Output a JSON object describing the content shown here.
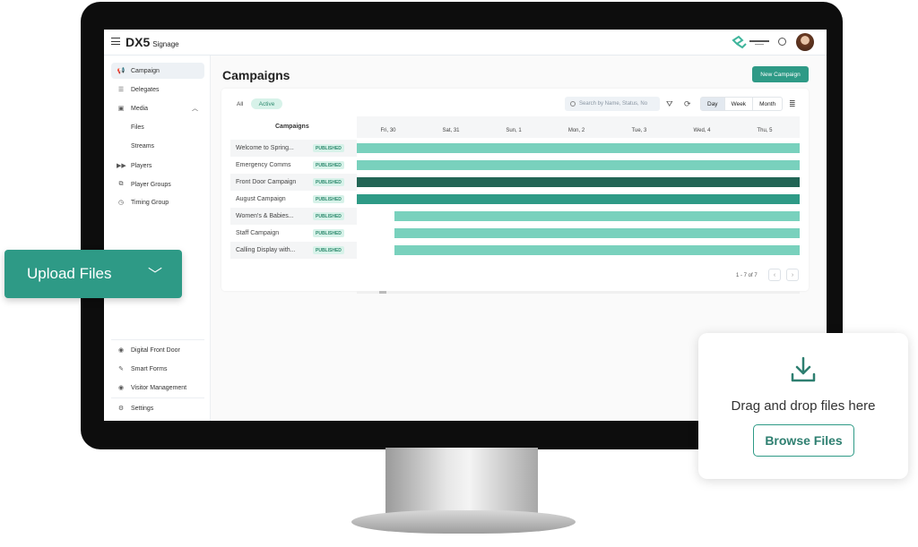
{
  "app": {
    "brand": "DX5",
    "brand_sub": "Signage",
    "logo_text": "SPRING RIVER"
  },
  "sidebar": {
    "items": [
      {
        "label": "Campaign",
        "icon": "megaphone-icon",
        "glyph": "📢"
      },
      {
        "label": "Delegates",
        "icon": "list-play-icon",
        "glyph": "☰"
      },
      {
        "label": "Media",
        "icon": "image-icon",
        "glyph": "▣"
      },
      {
        "label": "Files"
      },
      {
        "label": "Streams"
      },
      {
        "label": "Players",
        "icon": "fast-forward-icon",
        "glyph": "▶▶"
      },
      {
        "label": "Player Groups",
        "icon": "hierarchy-icon",
        "glyph": "⧉"
      },
      {
        "label": "Timing Group",
        "icon": "clock-icon",
        "glyph": "◷"
      }
    ],
    "bottom": [
      {
        "label": "Digital Front Door",
        "icon": "user-circle-icon",
        "glyph": "◉"
      },
      {
        "label": "Smart Forms",
        "icon": "form-icon",
        "glyph": "✎"
      },
      {
        "label": "Visitor Management",
        "icon": "user-circle-icon",
        "glyph": "◉"
      },
      {
        "label": "Settings",
        "icon": "gear-icon",
        "glyph": "⚙"
      }
    ]
  },
  "page": {
    "title": "Campaigns",
    "new_button": "New Campaign"
  },
  "filters": {
    "all": "All",
    "active": "Active",
    "search_placeholder": "Search by Name, Status, No",
    "views": [
      "Day",
      "Week",
      "Month"
    ],
    "selected_view": "Day"
  },
  "table": {
    "column": "Campaigns",
    "days": [
      "Fri, 30",
      "Sat, 31",
      "Sun, 1",
      "Mon, 2",
      "Tue, 3",
      "Wed, 4",
      "Thu, 5"
    ],
    "rows": [
      {
        "name": "Welcome to Spring...",
        "status": "PUBLISHED",
        "start_day": 0,
        "color": "#79d1bd"
      },
      {
        "name": "Emergency Comms",
        "status": "PUBLISHED",
        "start_day": 0,
        "color": "#79d1bd"
      },
      {
        "name": "Front Door Campaign",
        "status": "PUBLISHED",
        "start_day": 0,
        "color": "#226555"
      },
      {
        "name": "August Campaign",
        "status": "PUBLISHED",
        "start_day": 0,
        "color": "#2e9a86"
      },
      {
        "name": "Women's & Babies...",
        "status": "PUBLISHED",
        "start_day": 0.6,
        "color": "#79d1bd"
      },
      {
        "name": "Staff Campaign",
        "status": "PUBLISHED",
        "start_day": 0.6,
        "color": "#79d1bd"
      },
      {
        "name": "Calling Display with...",
        "status": "PUBLISHED",
        "start_day": 0.6,
        "color": "#79d1bd"
      }
    ]
  },
  "pagination": {
    "text": "1 - 7 of 7",
    "prev": "‹",
    "next": "›"
  },
  "upload": {
    "label": "Upload Files",
    "chevron": "⌄"
  },
  "dropzone": {
    "text": "Drag and drop files here",
    "button": "Browse Files"
  },
  "colors": {
    "accent": "#2e9a86"
  }
}
